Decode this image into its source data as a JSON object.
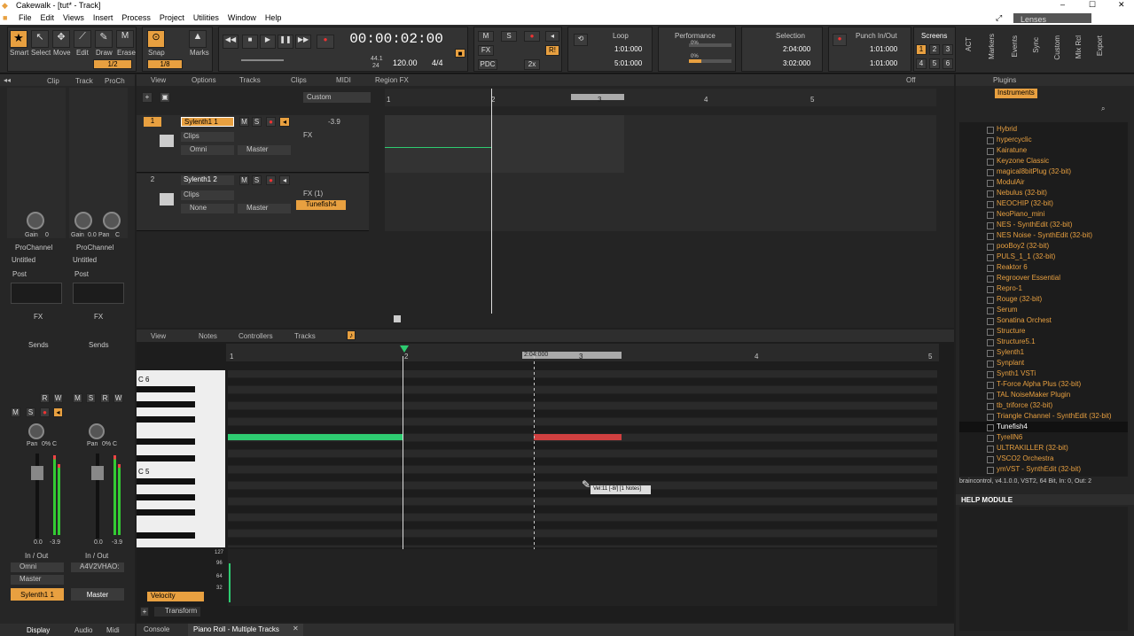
{
  "window": {
    "title": "Cakewalk - [tut* - Track]",
    "min": "–",
    "max": "☐",
    "close": "✕"
  },
  "menu": [
    "File",
    "Edit",
    "Views",
    "Insert",
    "Process",
    "Project",
    "Utilities",
    "Window",
    "Help"
  ],
  "menu_right": {
    "lenses_label": "Lenses"
  },
  "tools": {
    "smart": "Smart",
    "select": "Select",
    "move": "Move",
    "edit": "Edit",
    "draw": "Draw",
    "erase": "Erase",
    "snap": "Snap",
    "marks": "Marks",
    "snap_value": "1/8",
    "erase_value": "1/2"
  },
  "transport": {
    "time": "00:00:02:00",
    "sample_rate": "44.1",
    "bit_depth": "24",
    "tempo": "120.00",
    "meter": "4/4"
  },
  "mix": {
    "m": "M",
    "s": "S",
    "fx": "FX",
    "pdc": "PDC",
    "x2": "2x",
    "r": "R!"
  },
  "loop": {
    "title": "Loop",
    "start": "1:01:000",
    "end": "5:01:000"
  },
  "performance": {
    "title": "Performance",
    "row1": "0%",
    "row2": "0%"
  },
  "selection": {
    "title": "Selection",
    "start": "2:04:000",
    "end": "3:02:000"
  },
  "punch": {
    "title": "Punch In/Out",
    "start": "1:01:000",
    "end": "1:01:000"
  },
  "screensets": {
    "title": "Screens",
    "nums": [
      "1",
      "2",
      "3",
      "4",
      "5",
      "6"
    ]
  },
  "side_tabs": [
    "ACT",
    "Markers",
    "Events",
    "Sync",
    "Custom",
    "Mix Rcl",
    "Export"
  ],
  "inspector": {
    "tabs": [
      "Clip",
      "Track",
      "ProCh"
    ],
    "gain_label": "Gain",
    "gain_val": "0",
    "gain2": "0.0",
    "pan_label": "Pan",
    "pan_val": "C",
    "prochannel": "ProChannel",
    "untitled": "Untitled",
    "post": "Post",
    "fx": "FX",
    "sends": "Sends",
    "pan_pct": "0% C",
    "vol_left": "0.0",
    "vol_left2": "-3.9",
    "vol_right": "0.0",
    "vol_right2": "-3.9",
    "inout": "In / Out",
    "omni": "Omni",
    "master": "Master",
    "a4v": "A4V2VHAO:",
    "strip1": "Sylenth1 1",
    "strip2": "Master",
    "bottom_tabs": [
      "Display",
      "Audio",
      "Midi"
    ]
  },
  "trackview": {
    "menus": [
      "View",
      "Options",
      "Tracks",
      "Clips",
      "MIDI",
      "Region FX"
    ],
    "preset": "Custom",
    "off": "Off",
    "ruler": [
      "1",
      "2",
      "3",
      "4",
      "5"
    ],
    "tracks": [
      {
        "num": "1",
        "name": "Sylenth1 1",
        "clips": "Clips",
        "input": "Omni",
        "output": "Master",
        "fx": "FX",
        "vol": "-3.9"
      },
      {
        "num": "2",
        "name": "Sylenth1 2",
        "clips": "Clips",
        "input": "None",
        "output": "Master",
        "fx": "FX (1)",
        "plugin": "Tunefish4"
      }
    ]
  },
  "pianoroll": {
    "menus": [
      "View",
      "Notes",
      "Controllers",
      "Tracks"
    ],
    "ruler": [
      "1",
      "2",
      "3",
      "4",
      "5"
    ],
    "sel_label": "2:04:000",
    "c6": "C 6",
    "c5": "C 5",
    "tooltip": "Vel:11 [-8/] [1 Notes]",
    "velocity": "Velocity",
    "transform": "Transform",
    "vel_scale": [
      "127",
      "96",
      "64",
      "32"
    ]
  },
  "bottom_tabs": {
    "console": "Console",
    "pianoroll": "Piano Roll - Multiple Tracks"
  },
  "browser": {
    "tab": "Plugins",
    "instruments": "Instruments",
    "items": [
      "Hybrid",
      "hypercyclic",
      "Kairatune",
      "Keyzone Classic",
      "magical8bitPlug (32-bit)",
      "ModulAir",
      "Nebulus (32-bit)",
      "NEOCHIP (32-bit)",
      "NeoPiano_mini",
      "NES - SynthEdit (32-bit)",
      "NES Noise - SynthEdit (32-bit)",
      "pooBoy2 (32-bit)",
      "PULS_1_1 (32-bit)",
      "Reaktor 6",
      "Regroover Essential",
      "Repro-1",
      "Rouge (32-bit)",
      "Serum",
      "Sonatina Orchest",
      "Structure",
      "Structure5.1",
      "Sylenth1",
      "Synplant",
      "Synth1 VSTi",
      "T-Force Alpha Plus (32-bit)",
      "TAL NoiseMaker Plugin",
      "tb_triforce (32-bit)",
      "Triangle Channel - SynthEdit (32-bit)",
      "Tunefish4",
      "TyrellN6",
      "ULTRAKILLER (32-bit)",
      "VSCO2 Orchestra",
      "ymVST - SynthEdit (32-bit)"
    ],
    "selected_index": 28,
    "info": "braincontrol, v4.1.0.0, VST2, 64 Bit, In: 0, Out: 2",
    "help_title": "HELP MODULE"
  },
  "colors": {
    "accent": "#e8a040",
    "note_green": "#2ecc71",
    "note_red": "#d04040"
  }
}
